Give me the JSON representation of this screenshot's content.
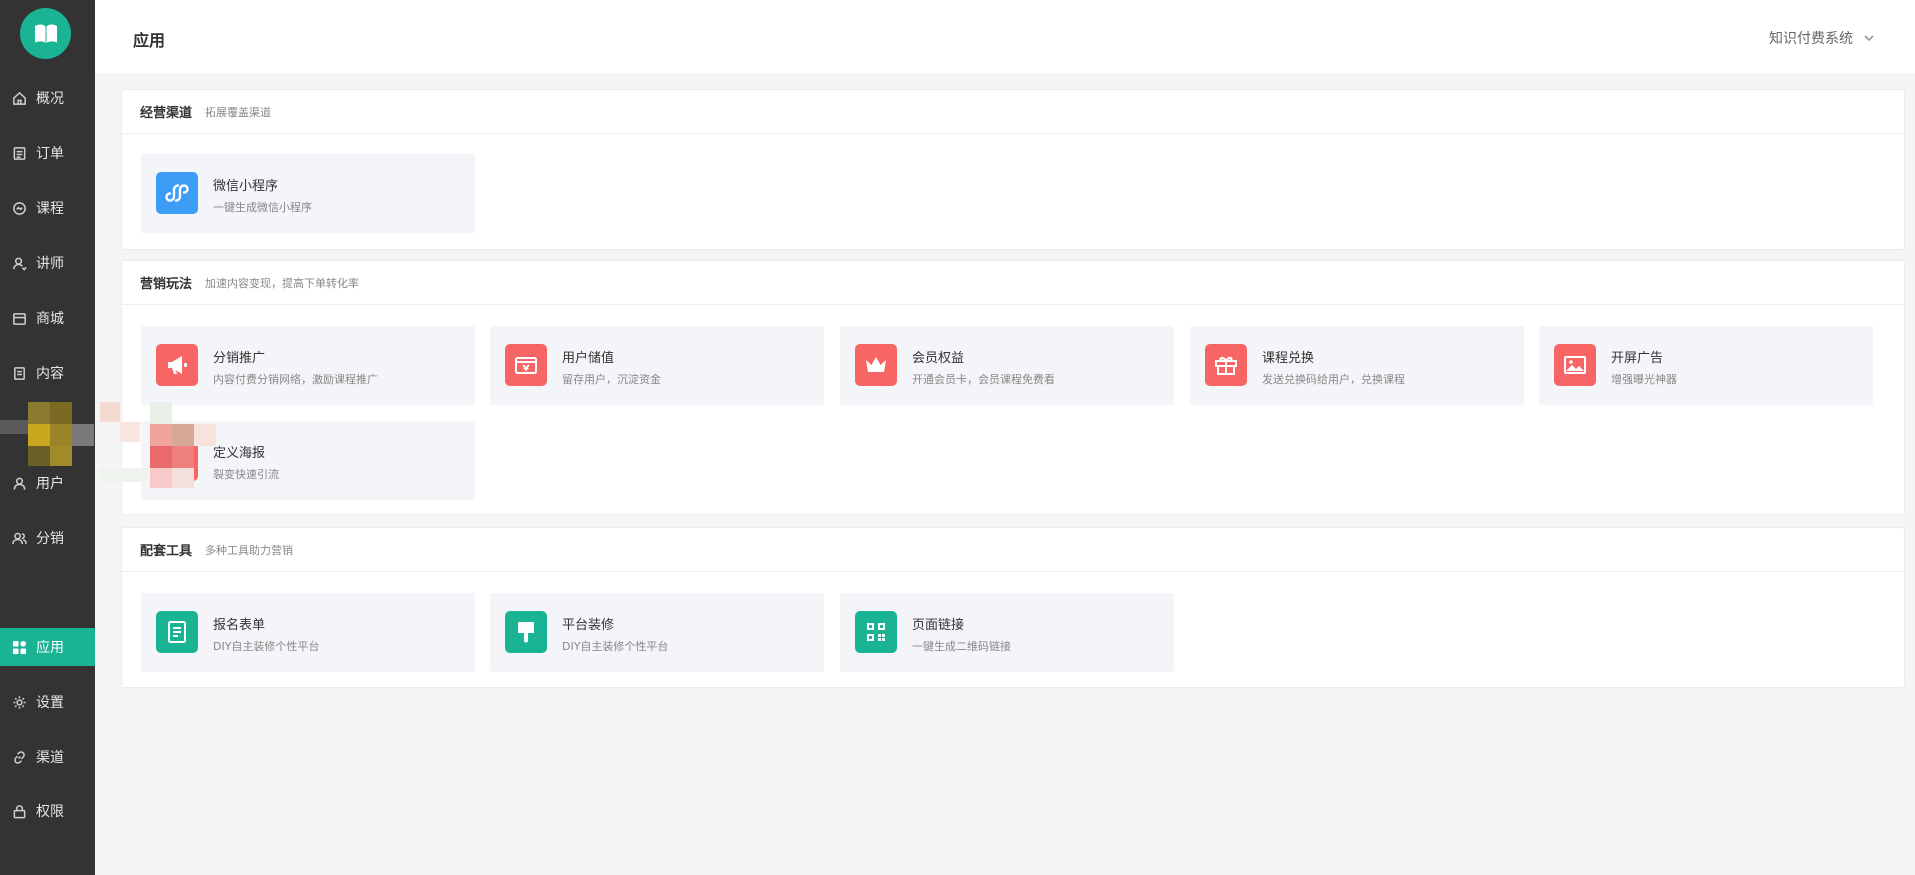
{
  "header": {
    "title": "应用",
    "system_select": "知识付费系统"
  },
  "sidebar": {
    "items": [
      {
        "label": "概况",
        "icon": "home-icon"
      },
      {
        "label": "订单",
        "icon": "order-icon"
      },
      {
        "label": "课程",
        "icon": "course-icon"
      },
      {
        "label": "讲师",
        "icon": "teacher-icon"
      },
      {
        "label": "商城",
        "icon": "shop-icon"
      },
      {
        "label": "内容",
        "icon": "content-icon"
      },
      {
        "label": "用户",
        "icon": "user-icon"
      },
      {
        "label": "分销",
        "icon": "distribution-icon"
      },
      {
        "label": "应用",
        "icon": "apps-icon",
        "active": true
      },
      {
        "label": "设置",
        "icon": "gear-icon"
      },
      {
        "label": "渠道",
        "icon": "link-icon"
      },
      {
        "label": "权限",
        "icon": "lock-icon"
      }
    ]
  },
  "sections": {
    "channel": {
      "title": "经营渠道",
      "subtitle": "拓展覆盖渠道",
      "apps": [
        {
          "name": "微信小程序",
          "desc": "一键生成微信小程序",
          "icon": "mini-program-icon",
          "color": "#3d9cf5"
        }
      ]
    },
    "marketing": {
      "title": "营销玩法",
      "subtitle": "加速内容变现，提高下单转化率",
      "apps": [
        {
          "name": "分销推广",
          "desc": "内容付费分销网络，激励课程推广",
          "icon": "megaphone-icon",
          "color": "#f76565"
        },
        {
          "name": "用户储值",
          "desc": "留存用户，沉淀资金",
          "icon": "wallet-icon",
          "color": "#f76565"
        },
        {
          "name": "会员权益",
          "desc": "开通会员卡，会员课程免费看",
          "icon": "crown-icon",
          "color": "#f76565"
        },
        {
          "name": "课程兑换",
          "desc": "发送兑换码给用户，兑换课程",
          "icon": "gift-icon",
          "color": "#f76565"
        },
        {
          "name": "开屏广告",
          "desc": "增强曝光神器",
          "icon": "image-icon",
          "color": "#f76565"
        },
        {
          "name": "定义海报",
          "desc": "裂变快速引流",
          "icon": "poster-icon",
          "color": "#f76565"
        }
      ]
    },
    "tools": {
      "title": "配套工具",
      "subtitle": "多种工具助力营销",
      "apps": [
        {
          "name": "报名表单",
          "desc": "DIY自主装修个性平台",
          "icon": "form-icon",
          "color": "#1ab394"
        },
        {
          "name": "平台装修",
          "desc": "DIY自主装修个性平台",
          "icon": "brush-icon",
          "color": "#1ab394"
        },
        {
          "name": "页面链接",
          "desc": "一键生成二维码链接",
          "icon": "qrcode-icon",
          "color": "#1ab394"
        }
      ]
    }
  }
}
